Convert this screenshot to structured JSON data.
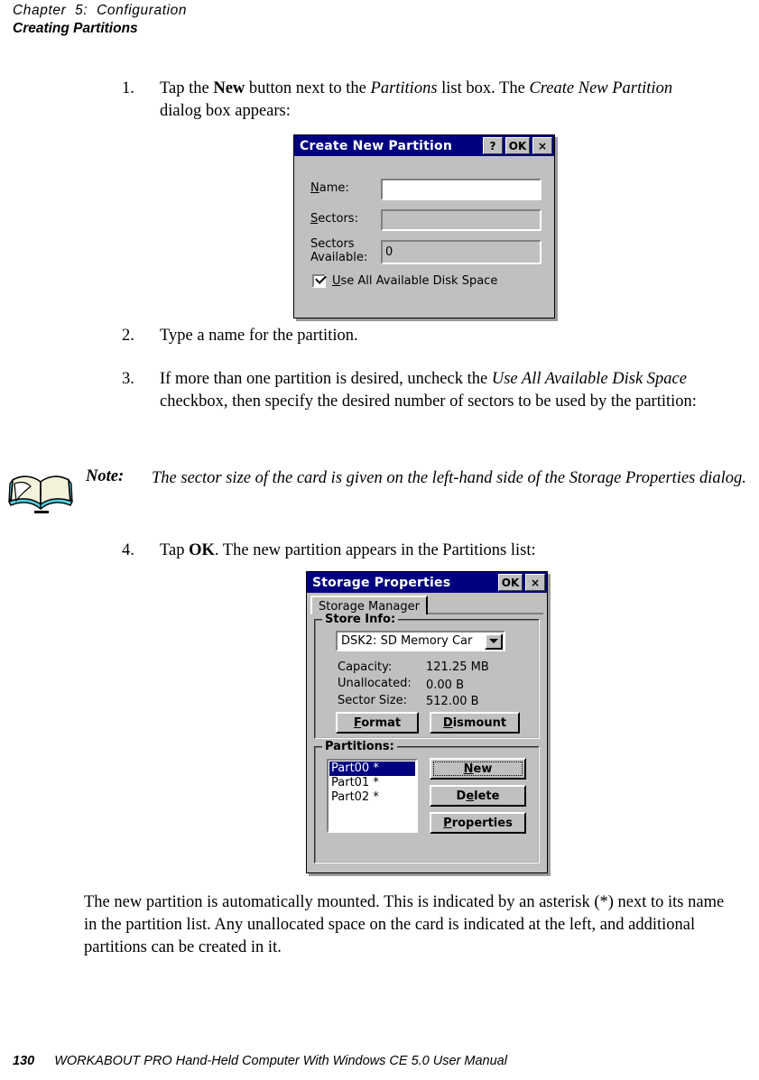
{
  "header": {
    "chapter": "Chapter  5:  Configuration",
    "section": "Creating Partitions"
  },
  "steps": {
    "step1": {
      "number": "1.",
      "text_parts": [
        "Tap the ",
        "New",
        " button next to the ",
        "Partitions",
        " list box. The ",
        "Create New Partition",
        " dialog box appears:"
      ]
    },
    "step2": {
      "number": "2.",
      "text": "Type a name for the partition."
    },
    "step3": {
      "number": "3.",
      "text_parts": [
        "If more than one partition is desired, uncheck the ",
        "Use All Available Disk Space",
        " checkbox, then specify the desired number of sectors to be used by the partition:"
      ]
    },
    "step4": {
      "number": "4.",
      "text_parts": [
        "Tap ",
        "OK",
        ". The new partition appears in the Partitions list:"
      ]
    }
  },
  "note": {
    "icon": "open-book-icon",
    "label": "Note:",
    "text": "The sector size of the card is given on the left-hand side of the Storage Properties dialog."
  },
  "closing_paragraph": "The new partition is automatically mounted. This is indicated by an asterisk (*) next to its name in the partition list. Any unallocated space on the card is indicated at the left, and additional partitions can be created in it.",
  "footer": {
    "page_number": "130",
    "manual_title": "WORKABOUT PRO Hand-Held Computer With Windows CE 5.0 User Manual"
  },
  "colors": {
    "titlebar": "#000080",
    "dialog_face": "#c0c0c0",
    "selection": "#000080",
    "note_icon_cover": "#4fd3e8",
    "note_icon_page": "#f5f2dc"
  },
  "dialog_create_new_partition": {
    "title": "Create New Partition",
    "title_buttons": [
      {
        "name": "help",
        "label": "?"
      },
      {
        "name": "ok",
        "label": "OK"
      },
      {
        "name": "close",
        "label": "×"
      }
    ],
    "fields": [
      {
        "label": "Name:",
        "mnemonic": "N",
        "value": "",
        "enabled": true
      },
      {
        "label": "Sectors:",
        "mnemonic": "S",
        "value": "",
        "enabled": false
      },
      {
        "label": "Sectors\nAvailable:",
        "mnemonic": "",
        "value": "0",
        "enabled": false
      }
    ],
    "checkbox": {
      "label": "Use All Available Disk Space",
      "mnemonic": "U",
      "checked": true
    }
  },
  "dialog_storage_properties": {
    "title": "Storage Properties",
    "title_buttons": [
      {
        "name": "ok",
        "label": "OK"
      },
      {
        "name": "close",
        "label": "×"
      }
    ],
    "tab": {
      "label": "Storage Manager",
      "selected": true
    },
    "store_info": {
      "group_label": "Store Info:",
      "dropdown_value": "DSK2: SD Memory Car",
      "rows": [
        {
          "label": "Capacity:",
          "value": "121.25 MB"
        },
        {
          "label": "Unallocated:",
          "value": "0.00 B"
        },
        {
          "label": "Sector Size:",
          "value": "512.00 B"
        }
      ],
      "buttons": [
        {
          "name": "format",
          "label": "Format",
          "mnemonic": "F"
        },
        {
          "name": "dismount",
          "label": "Dismount",
          "mnemonic": "D"
        }
      ]
    },
    "partitions": {
      "group_label": "Partitions:",
      "items": [
        {
          "label": "Part00 *",
          "selected": true
        },
        {
          "label": "Part01 *",
          "selected": false
        },
        {
          "label": "Part02 *",
          "selected": false
        }
      ],
      "buttons": [
        {
          "name": "new",
          "label": "New",
          "mnemonic": "N",
          "focused": true
        },
        {
          "name": "delete",
          "label": "Delete",
          "mnemonic": "e",
          "focused": false
        },
        {
          "name": "properties",
          "label": "Properties",
          "mnemonic": "P",
          "focused": false
        }
      ]
    }
  }
}
